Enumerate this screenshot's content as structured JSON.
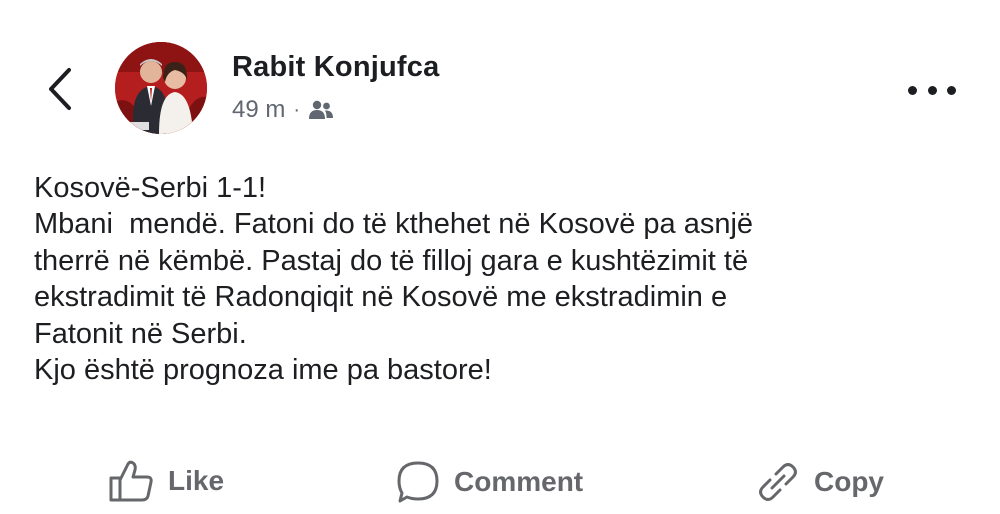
{
  "header": {
    "back_icon": "chevron-left-icon",
    "author_name": "Rabit Konjufca",
    "time_ago": "49 m",
    "separator": "·",
    "audience_icon": "friends-icon",
    "more_icon": "more-horizontal-icon",
    "avatar_colors": [
      "#b51e1e",
      "#ffffff"
    ]
  },
  "post": {
    "lines": [
      "Kosovë-Serbi 1-1!",
      "Mbani  mendë. Fatoni do të kthehet në Kosovë pa asnjë",
      "therrë në këmbë. Pastaj do të filloj gara e kushtëzimit të",
      "ekstradimit të Radonqiqit në Kosovë me ekstradimin e",
      "Fatonit në Serbi.",
      "Kjo është prognoza ime pa bastore!"
    ]
  },
  "actions": {
    "like_label": "Like",
    "like_icon": "thumbs-up-icon",
    "comment_label": "Comment",
    "comment_icon": "comment-bubble-icon",
    "copy_label": "Copy",
    "copy_icon": "link-icon",
    "color": "#65676b"
  }
}
